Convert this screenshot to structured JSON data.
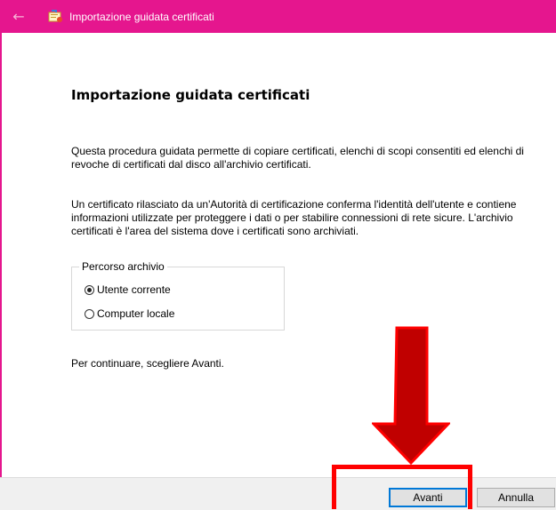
{
  "window": {
    "title": "Importazione guidata certificati",
    "titlebar_color": "#e5168e"
  },
  "wizard": {
    "heading": "Importazione guidata certificati",
    "paragraph1": "Questa procedura guidata permette di copiare certificati, elenchi di scopi consentiti ed elenchi di revoche di certificati dal disco all'archivio certificati.",
    "paragraph2": "Un certificato rilasciato da un'Autorità di certificazione conferma l'identità dell'utente e contiene informazioni utilizzate per proteggere i dati o per stabilire connessioni di rete sicure. L'archivio certificati è l'area del sistema dove i certificati sono archiviati.",
    "store_location": {
      "legend": "Percorso archivio",
      "options": [
        {
          "label": "Utente corrente",
          "selected": true
        },
        {
          "label": "Computer locale",
          "selected": false
        }
      ]
    },
    "continue_text": "Per continuare, scegliere Avanti."
  },
  "buttons": {
    "next": "Avanti",
    "cancel": "Annulla"
  },
  "annotation": {
    "arrow_color": "#cc0000",
    "box_color": "#ff0000"
  }
}
